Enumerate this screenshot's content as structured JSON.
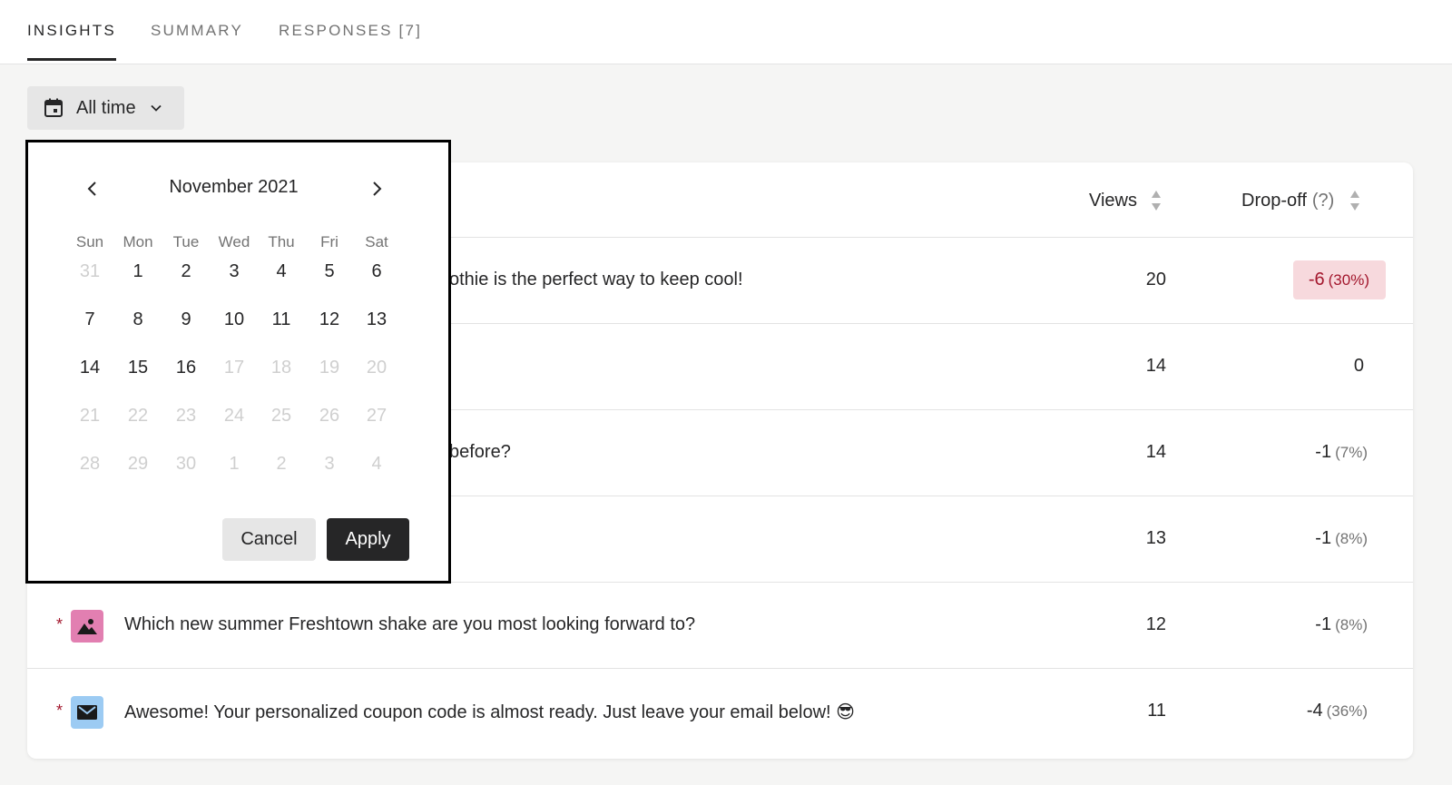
{
  "tabs": [
    {
      "label": "INSIGHTS",
      "active": true
    },
    {
      "label": "SUMMARY",
      "active": false
    },
    {
      "label": "RESPONSES [7]",
      "active": false
    }
  ],
  "filter": {
    "label": "All time",
    "icon": "calendar-icon"
  },
  "table": {
    "headers": {
      "views": "Views",
      "dropoff": "Drop-off",
      "dropoff_hint": "(?)"
    },
    "rows": [
      {
        "required": false,
        "icon": "",
        "question": "othie is the perfect way to keep cool!",
        "views": "20",
        "drop": "-6",
        "pct": "(30%)",
        "highlight": true
      },
      {
        "required": false,
        "icon": "",
        "question": "",
        "views": "14",
        "drop": "0",
        "pct": "",
        "highlight": false
      },
      {
        "required": false,
        "icon": "",
        "question": "before?",
        "views": "14",
        "drop": "-1",
        "pct": "(7%)",
        "highlight": false
      },
      {
        "required": false,
        "icon": "",
        "question": "",
        "views": "13",
        "drop": "-1",
        "pct": "(8%)",
        "highlight": false
      },
      {
        "required": true,
        "icon": "image-icon",
        "question": "Which new summer Freshtown shake are you most looking forward to?",
        "views": "12",
        "drop": "-1",
        "pct": "(8%)",
        "highlight": false
      },
      {
        "required": true,
        "icon": "email-icon",
        "question": "Awesome! Your personalized coupon code is almost ready. Just leave your email below! 😎",
        "views": "11",
        "drop": "-4",
        "pct": "(36%)",
        "highlight": false
      }
    ]
  },
  "calendar": {
    "title": "November 2021",
    "weekdays": [
      "Sun",
      "Mon",
      "Tue",
      "Wed",
      "Thu",
      "Fri",
      "Sat"
    ],
    "weeks": [
      [
        {
          "d": "31",
          "m": true
        },
        {
          "d": "1",
          "m": false
        },
        {
          "d": "2",
          "m": false
        },
        {
          "d": "3",
          "m": false
        },
        {
          "d": "4",
          "m": false
        },
        {
          "d": "5",
          "m": false
        },
        {
          "d": "6",
          "m": false
        }
      ],
      [
        {
          "d": "7",
          "m": false
        },
        {
          "d": "8",
          "m": false
        },
        {
          "d": "9",
          "m": false
        },
        {
          "d": "10",
          "m": false
        },
        {
          "d": "11",
          "m": false
        },
        {
          "d": "12",
          "m": false
        },
        {
          "d": "13",
          "m": false
        }
      ],
      [
        {
          "d": "14",
          "m": false
        },
        {
          "d": "15",
          "m": false
        },
        {
          "d": "16",
          "m": false
        },
        {
          "d": "17",
          "m": true
        },
        {
          "d": "18",
          "m": true
        },
        {
          "d": "19",
          "m": true
        },
        {
          "d": "20",
          "m": true
        }
      ],
      [
        {
          "d": "21",
          "m": true
        },
        {
          "d": "22",
          "m": true
        },
        {
          "d": "23",
          "m": true
        },
        {
          "d": "24",
          "m": true
        },
        {
          "d": "25",
          "m": true
        },
        {
          "d": "26",
          "m": true
        },
        {
          "d": "27",
          "m": true
        }
      ],
      [
        {
          "d": "28",
          "m": true
        },
        {
          "d": "29",
          "m": true
        },
        {
          "d": "30",
          "m": true
        },
        {
          "d": "1",
          "m": true
        },
        {
          "d": "2",
          "m": true
        },
        {
          "d": "3",
          "m": true
        },
        {
          "d": "4",
          "m": true
        }
      ]
    ],
    "cancel_label": "Cancel",
    "apply_label": "Apply"
  },
  "colors": {
    "image_icon_bg": "#e27fb1",
    "email_icon_bg": "#9ccbf3",
    "highlight_bg": "#f7d9dd",
    "highlight_text": "#a3172d"
  }
}
